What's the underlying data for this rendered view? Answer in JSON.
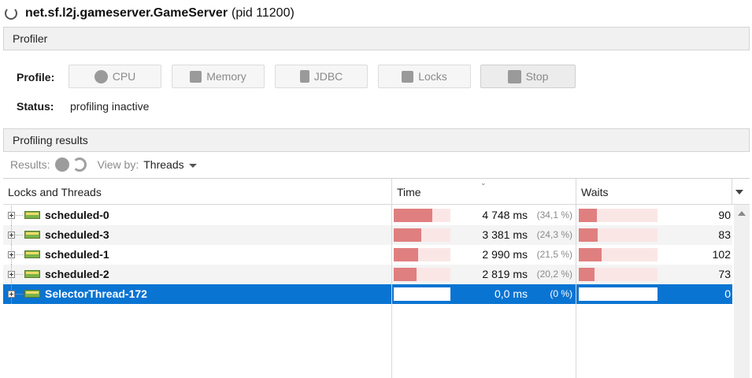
{
  "window": {
    "title": "net.sf.l2j.gameserver.GameServer",
    "pid": "(pid 11200)"
  },
  "profiler_section": {
    "title": "Profiler"
  },
  "profile": {
    "label": "Profile:",
    "buttons": [
      {
        "label": "CPU",
        "icon": "cpu-icon"
      },
      {
        "label": "Memory",
        "icon": "memory-icon"
      },
      {
        "label": "JDBC",
        "icon": "jdbc-icon"
      },
      {
        "label": "Locks",
        "icon": "locks-icon"
      },
      {
        "label": "Stop",
        "icon": "stop-icon"
      }
    ]
  },
  "status": {
    "label": "Status:",
    "value": "profiling inactive"
  },
  "results_section": {
    "title": "Profiling results"
  },
  "results_toolbar": {
    "results_label": "Results:",
    "view_by_label": "View by:",
    "view_by_value": "Threads"
  },
  "table": {
    "columns": [
      "Locks and Threads",
      "Time",
      "Waits"
    ],
    "rows": [
      {
        "name": "scheduled-0",
        "time": "4 748 ms",
        "percent": "(34,1 %)",
        "time_fraction": 0.341,
        "waits": "90",
        "waits_fraction": 0.23
      },
      {
        "name": "scheduled-3",
        "time": "3 381 ms",
        "percent": "(24,3 %)",
        "time_fraction": 0.243,
        "waits": "83",
        "waits_fraction": 0.24
      },
      {
        "name": "scheduled-1",
        "time": "2 990 ms",
        "percent": "(21,5 %)",
        "time_fraction": 0.215,
        "waits": "102",
        "waits_fraction": 0.29
      },
      {
        "name": "scheduled-2",
        "time": "2 819 ms",
        "percent": "(20,2 %)",
        "time_fraction": 0.202,
        "waits": "73",
        "waits_fraction": 0.2
      },
      {
        "name": "SelectorThread-172",
        "time": "0,0 ms",
        "percent": "(0 %)",
        "time_fraction": 0,
        "waits": "0",
        "waits_fraction": 0,
        "selected": true
      }
    ]
  }
}
